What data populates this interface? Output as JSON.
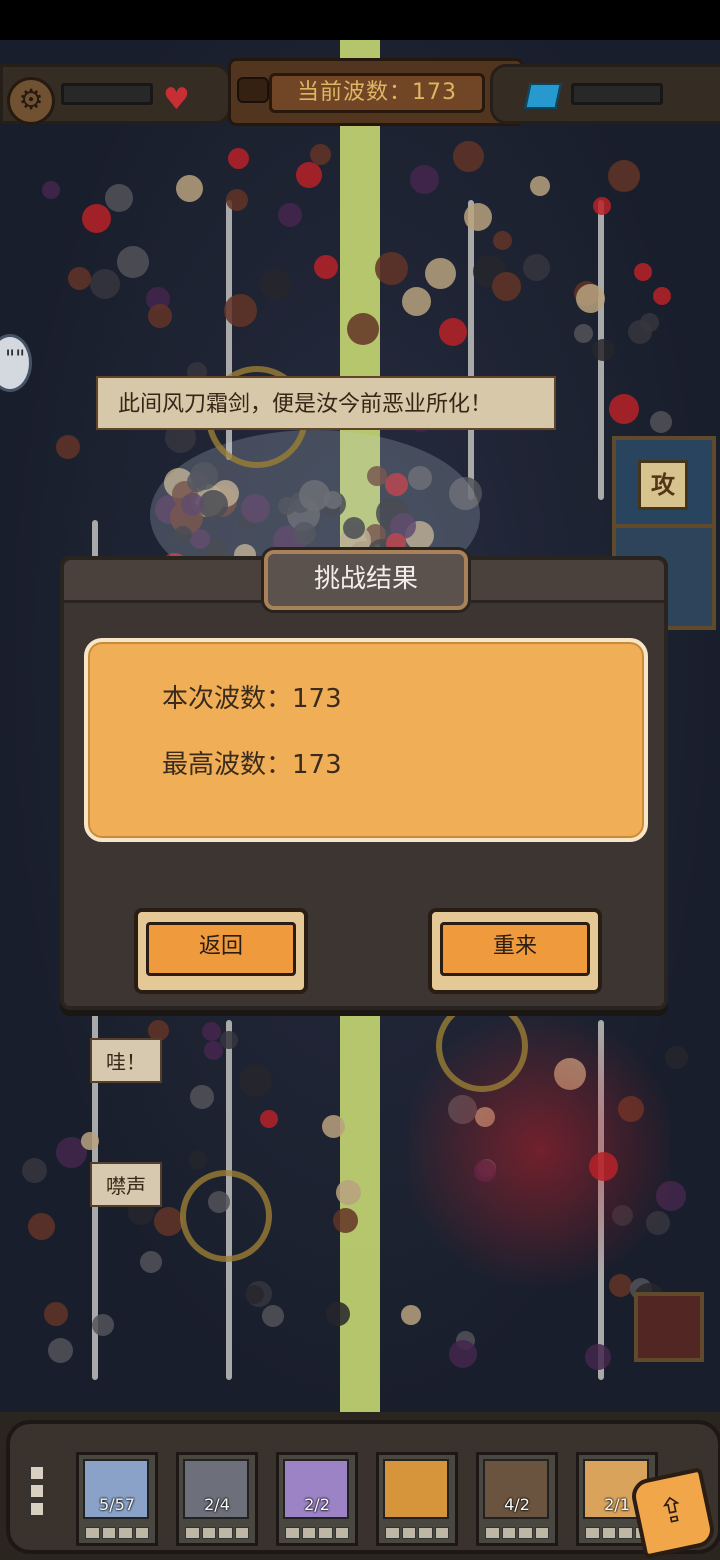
{
  "hud": {
    "wave_label": "当前波数：173"
  },
  "banner": {
    "text": "此间风刀霜剑，便是汝今前恶业所化！"
  },
  "speech_bubbles": [
    "哇！",
    "噤声"
  ],
  "dialog": {
    "title": "挑战结果",
    "current_wave": "本次波数：173",
    "best_wave": "最高波数：173",
    "back_button": "返回",
    "retry_button": "重来"
  },
  "side_card": {
    "emblem": "攻"
  },
  "unit_bar": {
    "units": [
      {
        "count": "5/57",
        "portrait_color": "#8aa2c7"
      },
      {
        "count": "2/4",
        "portrait_color": "#6d6f7a"
      },
      {
        "count": "2/2",
        "portrait_color": "#9b83c6"
      },
      {
        "count": "",
        "portrait_color": "#d7953b"
      },
      {
        "count": "4/2",
        "portrait_color": "#6a5440"
      },
      {
        "count": "2/1",
        "portrait_color": "#d9a35c"
      }
    ]
  },
  "colors": {
    "accent_orange": "#f0ae56",
    "button_orange": "#ef9a3c",
    "dialog_bg": "#3c3532",
    "lane_green": "#cfe07a",
    "enemy_red": "#c8242c"
  },
  "icons": {
    "settings": "gear-icon",
    "life": "heart-icon",
    "currency": "gem-icon",
    "share": "share-icon"
  }
}
